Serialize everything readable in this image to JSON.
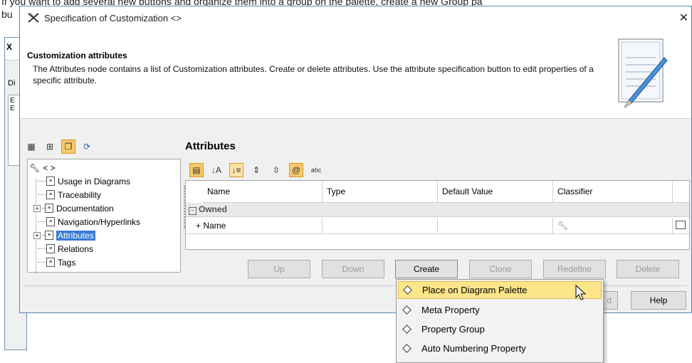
{
  "background": {
    "line1": "If you want to add several new buttons and organize them into a group on the palette, create a new Group pa",
    "line2": "bu",
    "back_window": {
      "title_char": "X",
      "label": "Di",
      "items": [
        "E",
        "E"
      ]
    }
  },
  "dialog": {
    "title": "Specification of Customization <>",
    "close_glyph": "✕",
    "info": {
      "title": "Customization attributes",
      "description": "The Attributes node contains a list of Customization attributes. Create or delete attributes. Use the attribute specification button to edit properties of a specific attribute."
    },
    "tree": {
      "root": "< >",
      "items": [
        {
          "label": "Usage in Diagrams",
          "expandable": false,
          "selected": false
        },
        {
          "label": "Traceability",
          "expandable": false,
          "selected": false
        },
        {
          "label": "Documentation",
          "expandable": true,
          "selected": false
        },
        {
          "label": "Navigation/Hyperlinks",
          "expandable": false,
          "selected": false
        },
        {
          "label": "Attributes",
          "expandable": true,
          "selected": true
        },
        {
          "label": "Relations",
          "expandable": false,
          "selected": false
        },
        {
          "label": "Tags",
          "expandable": false,
          "selected": false
        }
      ]
    },
    "attributes": {
      "title": "Attributes",
      "columns": [
        "Name",
        "Type",
        "Default Value",
        "Classifier"
      ],
      "group": "Owned",
      "row": {
        "name": "+ Name",
        "type": "",
        "default": "",
        "classifier_icon": "wrench-icon"
      }
    },
    "buttons": {
      "up": "Up",
      "down": "Down",
      "create": "Create",
      "clone": "Clone",
      "redefine": "Redefine",
      "delete": "Delete"
    },
    "bottom": {
      "close_partial": "d",
      "help": "Help"
    }
  },
  "create_menu": {
    "items": [
      {
        "label": "Place on Diagram Palette",
        "highlighted": true
      },
      {
        "label": "Meta Property",
        "highlighted": false
      },
      {
        "label": "Property Group",
        "highlighted": false
      },
      {
        "label": "Auto Numbering Property",
        "highlighted": false
      }
    ]
  },
  "colors": {
    "selection": "#3a7bd5",
    "highlight": "#fde58a",
    "toggle_on": "#f7c86a"
  }
}
